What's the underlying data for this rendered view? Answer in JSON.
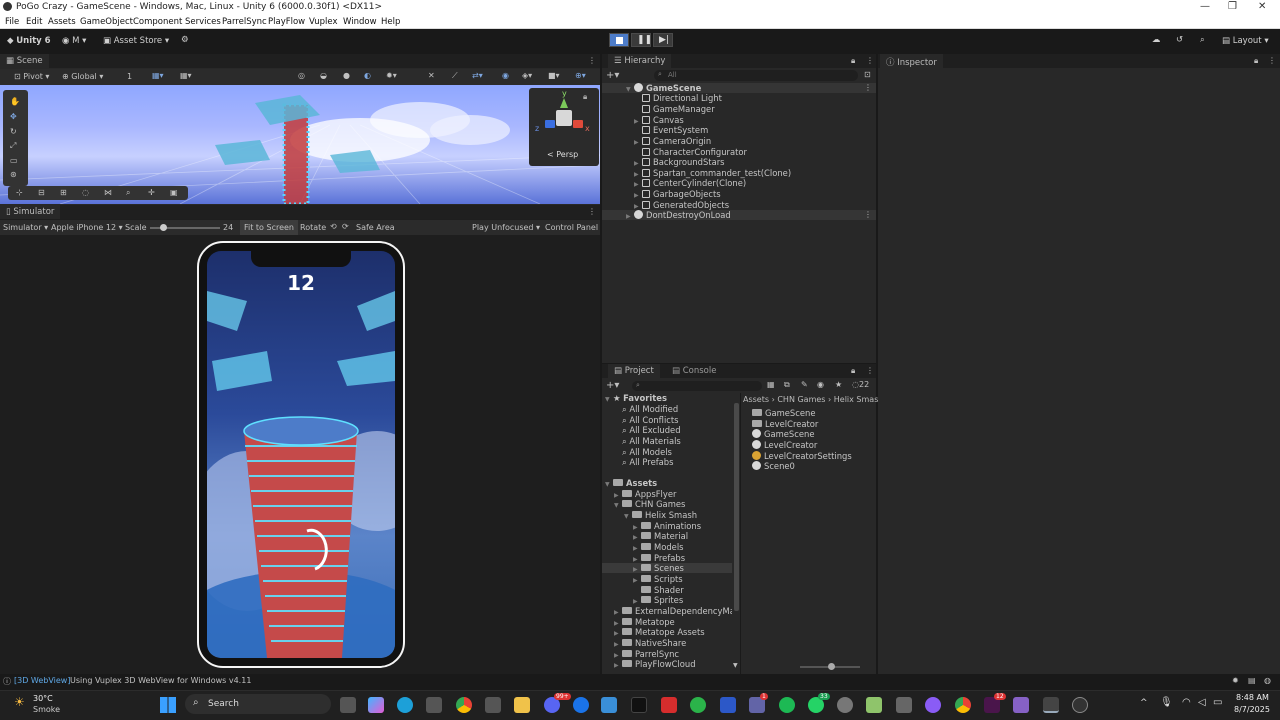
{
  "window": {
    "title": "PoGo Crazy - GameScene - Windows, Mac, Linux - Unity 6 (6000.0.30f1) <DX11>"
  },
  "menu": [
    "File",
    "Edit",
    "Assets",
    "GameObject",
    "Component",
    "Services",
    "ParrelSync",
    "PlayFlow",
    "Vuplex",
    "Window",
    "Help"
  ],
  "toolbar": {
    "account": "Unity 6",
    "user": "M",
    "asset_store": "Asset Store",
    "layout": "Layout"
  },
  "scene": {
    "tab": "Scene",
    "pivot": "Pivot",
    "global": "Global",
    "snap": "1",
    "persp": "< Persp",
    "gizmo_axes": [
      "y",
      "x",
      "z"
    ]
  },
  "simulator": {
    "tab": "Simulator",
    "mode": "Simulator",
    "device": "Apple iPhone 12",
    "scale_label": "Scale",
    "scale_value": "24",
    "fit": "Fit to Screen",
    "rotate": "Rotate",
    "safe_area": "Safe Area",
    "play_mode": "Play Unfocused",
    "control_panel": "Control Panel",
    "score": "12"
  },
  "hierarchy": {
    "tab": "Hierarchy",
    "search": "All",
    "scene": "GameScene",
    "items": [
      "Directional Light",
      "GameManager",
      "Canvas",
      "EventSystem",
      "CameraOrigin",
      "CharacterConfigurator",
      "BackgroundStars",
      "Spartan_commander_test(Clone)",
      "CenterCylinder(Clone)",
      "GarbageObjects",
      "GeneratedObjects"
    ],
    "dont_destroy": "DontDestroyOnLoad"
  },
  "inspector": {
    "tab": "Inspector"
  },
  "project": {
    "tab": "Project",
    "console_tab": "Console",
    "hidden_count": "22",
    "favorites_label": "Favorites",
    "favorites": [
      "All Modified",
      "All Conflicts",
      "All Excluded",
      "All Materials",
      "All Models",
      "All Prefabs"
    ],
    "assets_label": "Assets",
    "tree": [
      {
        "label": "AppsFlyer",
        "level": 1
      },
      {
        "label": "CHN Games",
        "level": 1
      },
      {
        "label": "Helix Smash",
        "level": 2
      },
      {
        "label": "Animations",
        "level": 3
      },
      {
        "label": "Material",
        "level": 3
      },
      {
        "label": "Models",
        "level": 3
      },
      {
        "label": "Prefabs",
        "level": 3
      },
      {
        "label": "Scenes",
        "level": 3
      },
      {
        "label": "Scripts",
        "level": 3
      },
      {
        "label": "Shader",
        "level": 3
      },
      {
        "label": "Sprites",
        "level": 3
      },
      {
        "label": "ExternalDependencyManc",
        "level": 1
      },
      {
        "label": "Metatope",
        "level": 1
      },
      {
        "label": "Metatope Assets",
        "level": 1
      },
      {
        "label": "NativeShare",
        "level": 1
      },
      {
        "label": "ParrelSync",
        "level": 1
      },
      {
        "label": "PlayFlowCloud",
        "level": 1
      }
    ],
    "breadcrumb": [
      "Assets",
      "CHN Games",
      "Helix Smas"
    ],
    "files": [
      {
        "label": "GameScene",
        "icon": "folder"
      },
      {
        "label": "LevelCreator",
        "icon": "folder"
      },
      {
        "label": "GameScene",
        "icon": "unity"
      },
      {
        "label": "LevelCreator",
        "icon": "unity"
      },
      {
        "label": "LevelCreatorSettings",
        "icon": "settings"
      },
      {
        "label": "Scene0",
        "icon": "unity"
      }
    ]
  },
  "status": {
    "tag": "[3D WebView]",
    "message": "Using Vuplex 3D WebView for Windows v4.11"
  },
  "taskbar": {
    "weather_temp": "30°C",
    "weather_desc": "Smoke",
    "search": "Search",
    "time": "8:48 AM",
    "date": "8/7/2025",
    "badges": [
      "99+",
      "1",
      "33",
      "12"
    ]
  }
}
